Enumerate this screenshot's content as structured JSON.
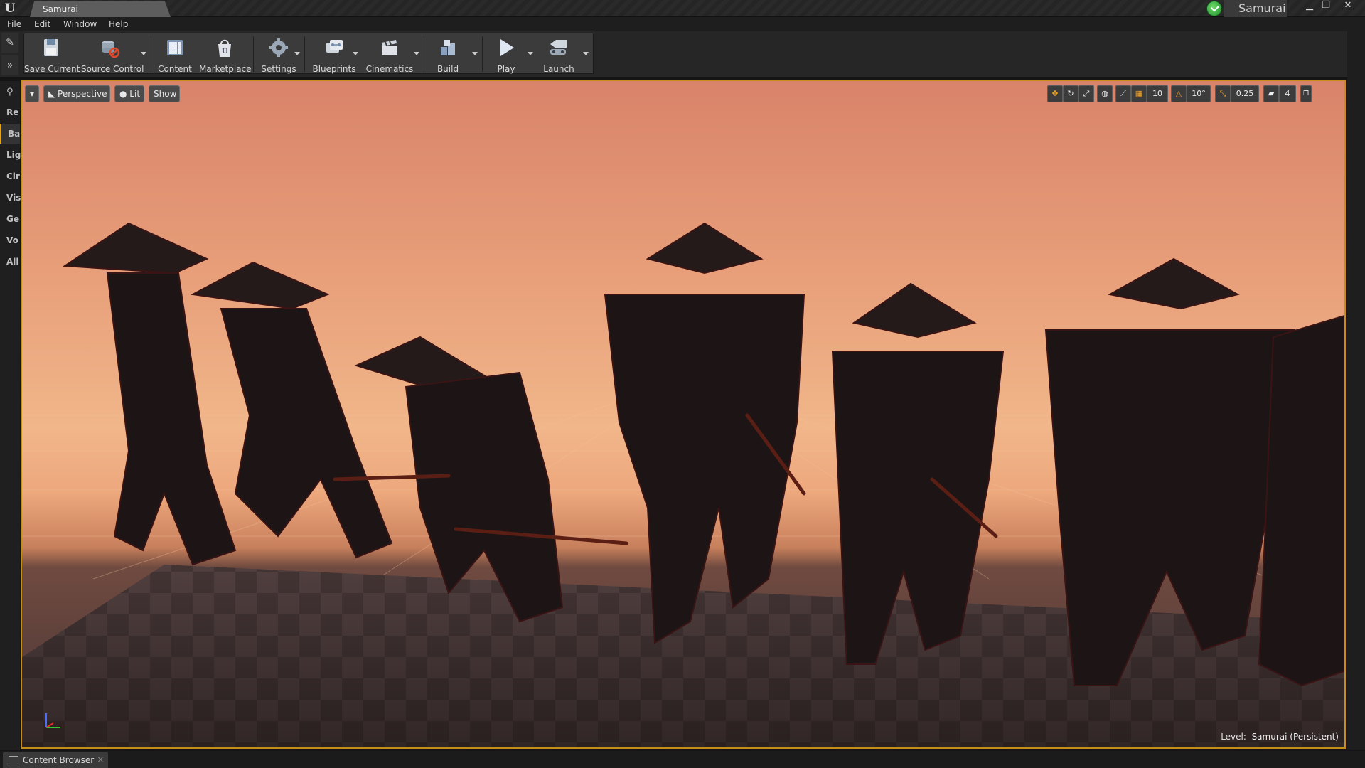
{
  "window": {
    "doc_tab_title": "Samurai",
    "project_name": "Samurai",
    "controls": {
      "minimize": "▁",
      "restore": "❐",
      "close": "✕"
    }
  },
  "menu": [
    "File",
    "Edit",
    "Window",
    "Help"
  ],
  "toolbar": {
    "buttons": [
      {
        "label": "Save Current",
        "icon": "save-icon"
      },
      {
        "label": "Source Control",
        "icon": "source-control-icon"
      },
      {
        "label": "Content",
        "icon": "content-icon"
      },
      {
        "label": "Marketplace",
        "icon": "marketplace-icon"
      },
      {
        "label": "Settings",
        "icon": "settings-icon"
      },
      {
        "label": "Blueprints",
        "icon": "blueprints-icon"
      },
      {
        "label": "Cinematics",
        "icon": "cinematics-icon"
      },
      {
        "label": "Build",
        "icon": "build-icon"
      },
      {
        "label": "Play",
        "icon": "play-icon"
      },
      {
        "label": "Launch",
        "icon": "launch-icon"
      }
    ]
  },
  "modes_panel": {
    "tabs": [
      "Re",
      "Ba",
      "Lig",
      "Cir",
      "Vis",
      "Ge",
      "Vo",
      "All"
    ],
    "active": "Ba"
  },
  "viewport": {
    "view_mode": "Perspective",
    "lighting": "Lit",
    "show": "Show",
    "grid_snap": "10",
    "rotation_snap": "10°",
    "scale_snap": "0.25",
    "camera_speed": "4",
    "level_prefix": "Level:",
    "level_name": "Samurai (Persistent)",
    "accent_color": "#f0a020",
    "border_color": "#c58d1a"
  },
  "bottom": {
    "content_browser_tab": "Content Browser",
    "close": "✕"
  }
}
